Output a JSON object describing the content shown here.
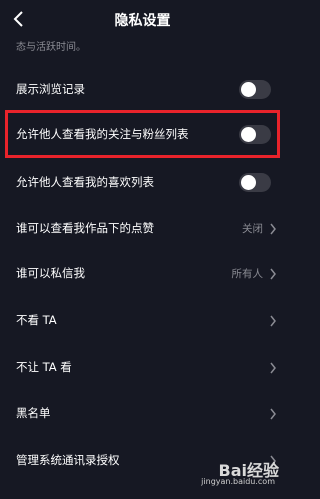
{
  "header": {
    "title": "隐私设置"
  },
  "note": "态与活跃时间。",
  "rows": [
    {
      "label": "展示浏览记录",
      "type": "toggle"
    },
    {
      "label": "允许他人查看我的关注与粉丝列表",
      "type": "toggle"
    },
    {
      "label": "允许他人查看我的喜欢列表",
      "type": "toggle"
    },
    {
      "label": "谁可以查看我作品下的点赞",
      "value": "关闭",
      "type": "link"
    },
    {
      "label": "谁可以私信我",
      "value": "所有人",
      "type": "link"
    },
    {
      "label": "不看 TA",
      "type": "link"
    },
    {
      "label": "不让 TA 看",
      "type": "link"
    },
    {
      "label": "黑名单",
      "type": "link"
    },
    {
      "label": "管理系统通讯录授权",
      "type": "link"
    }
  ],
  "watermark": {
    "logo": "Bai经验",
    "url": "jingyan.baidu.com"
  },
  "colors": {
    "background": "#161823",
    "highlight": "#e8232b",
    "toggle_off": "#3a3b45",
    "secondary_text": "#8a8b93"
  }
}
